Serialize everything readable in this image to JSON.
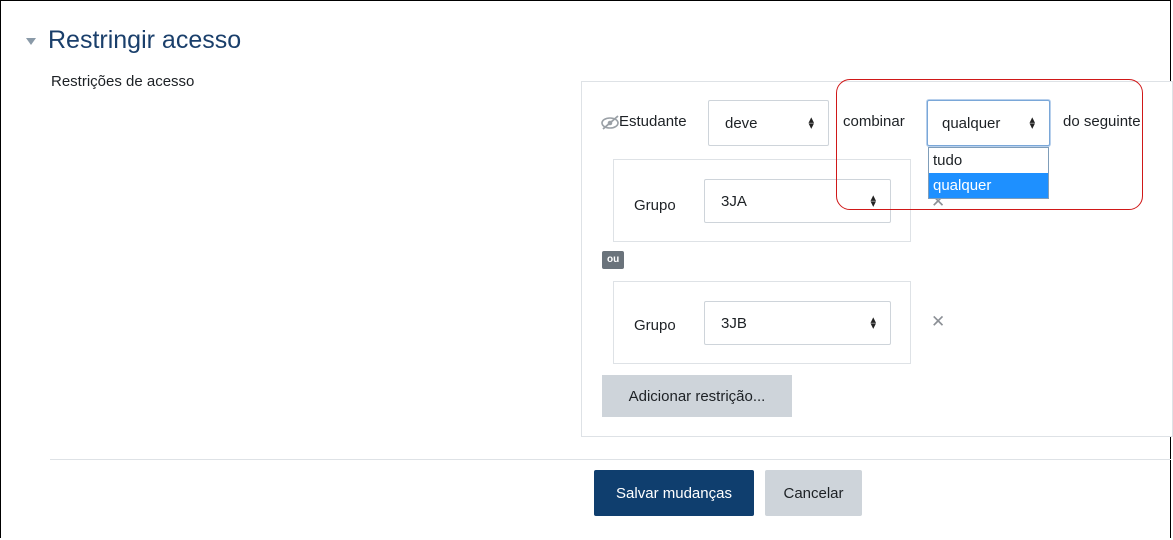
{
  "section": {
    "title": "Restringir acesso",
    "field_label": "Restrições de acesso"
  },
  "restriction_header": {
    "student_label": "Estudante",
    "must_select_value": "deve",
    "combine_label": "combinar",
    "combine_select_value": "qualquer",
    "following_label": "do seguinte",
    "combine_options": [
      "tudo",
      "qualquer"
    ],
    "combine_selected_option": "qualquer"
  },
  "conditions": [
    {
      "label": "Grupo",
      "value": "3JA"
    },
    {
      "label": "Grupo",
      "value": "3JB"
    }
  ],
  "or_badge": "ou",
  "add_restriction_label": "Adicionar restrição...",
  "actions": {
    "save_label": "Salvar mudanças",
    "cancel_label": "Cancelar"
  },
  "colors": {
    "title": "#1a3f6b",
    "primary_button": "#0f3e6e",
    "secondary_button": "#ced4da",
    "dropdown_highlight": "#1e90ff",
    "annotation": "#d01818"
  },
  "icons": {
    "collapse": "triangle-down-icon",
    "eye": "eye-slash-icon",
    "remove": "close-icon"
  }
}
